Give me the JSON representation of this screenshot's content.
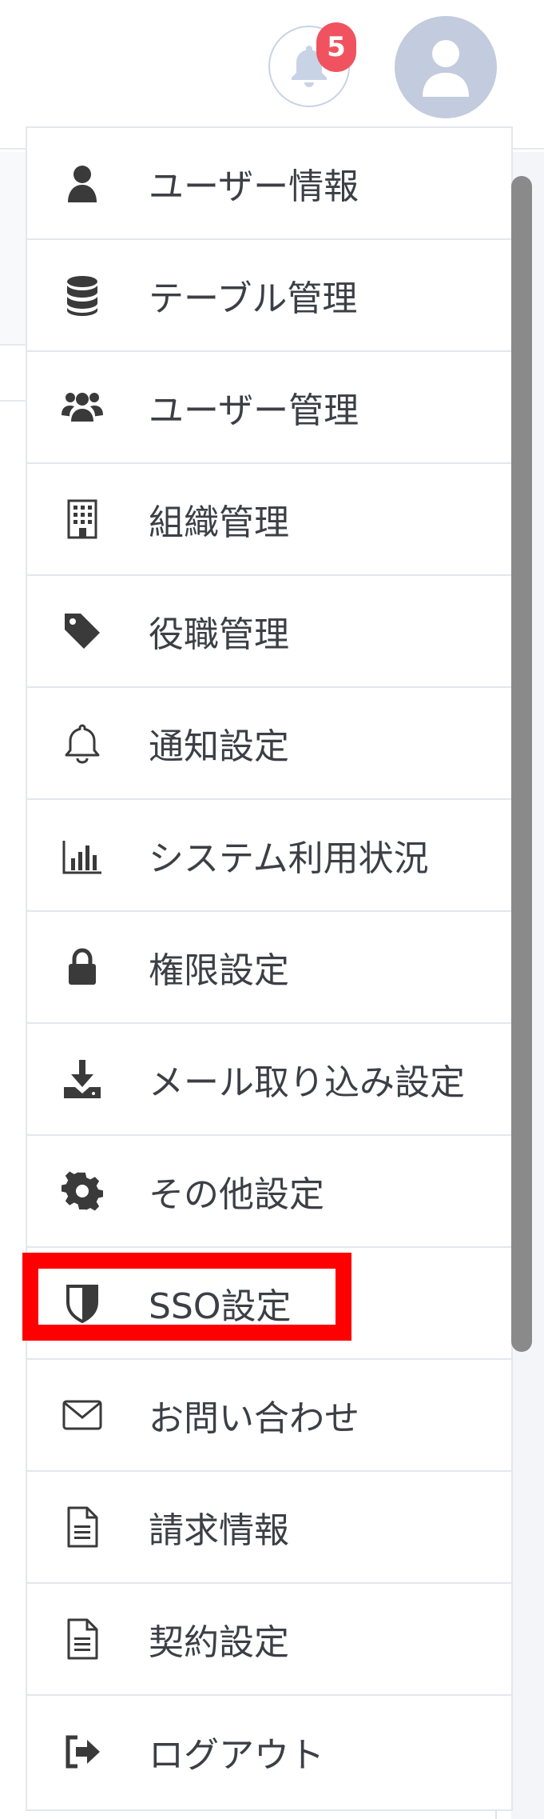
{
  "header": {
    "notification_count": "5",
    "bell_icon": "bell-icon",
    "avatar_icon": "user-icon",
    "badge_color": "#f0535f",
    "avatar_color": "#c3cbde"
  },
  "menu": {
    "items": [
      {
        "label": "ユーザー情報",
        "icon": "user-icon"
      },
      {
        "label": "テーブル管理",
        "icon": "database-icon"
      },
      {
        "label": "ユーザー管理",
        "icon": "users-icon"
      },
      {
        "label": "組織管理",
        "icon": "building-icon"
      },
      {
        "label": "役職管理",
        "icon": "tag-icon"
      },
      {
        "label": "通知設定",
        "icon": "bell-outline-icon"
      },
      {
        "label": "システム利用状況",
        "icon": "bar-chart-icon"
      },
      {
        "label": "権限設定",
        "icon": "lock-icon"
      },
      {
        "label": "メール取り込み設定",
        "icon": "download-icon"
      },
      {
        "label": "その他設定",
        "icon": "gear-icon"
      },
      {
        "label": "SSO設定",
        "icon": "shield-icon"
      },
      {
        "label": "お問い合わせ",
        "icon": "envelope-icon"
      },
      {
        "label": "請求情報",
        "icon": "document-icon"
      },
      {
        "label": "契約設定",
        "icon": "document-icon"
      },
      {
        "label": "ログアウト",
        "icon": "logout-icon"
      }
    ],
    "highlighted_item": "SSO設定",
    "highlight_color": "#ff0000"
  }
}
